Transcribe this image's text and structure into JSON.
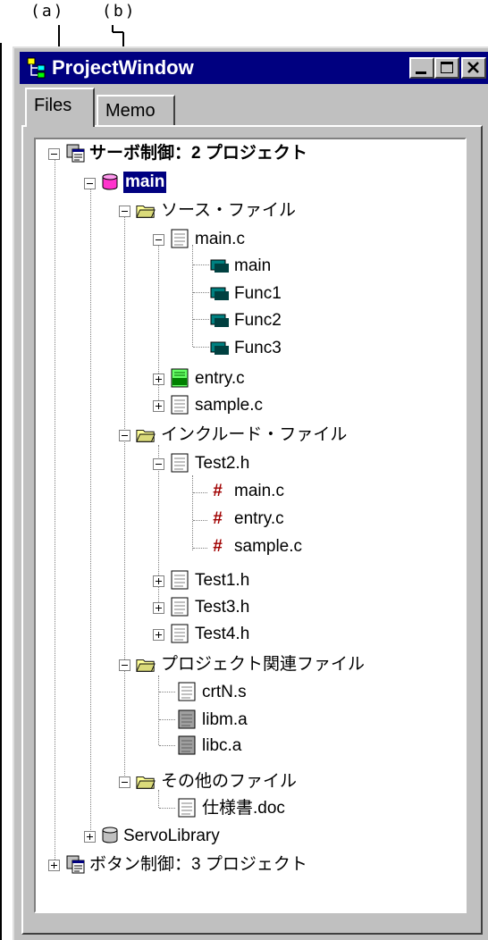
{
  "annotations": {
    "a": "(a)",
    "b": "(b)"
  },
  "window": {
    "title": "ProjectWindow"
  },
  "tabs": [
    {
      "label": "Files",
      "active": true
    },
    {
      "label": "Memo",
      "active": false
    }
  ],
  "tree": {
    "project1": "サーボ制御：2 プロジェクト",
    "main": "main",
    "source_folder": "ソース・ファイル",
    "main_c": "main.c",
    "fn_main": "main",
    "fn1": "Func1",
    "fn2": "Func2",
    "fn3": "Func3",
    "entry_c": "entry.c",
    "sample_c": "sample.c",
    "include_folder": "インクルード・ファイル",
    "test2_h": "Test2.h",
    "inc_main_c": "main.c",
    "inc_entry_c": "entry.c",
    "inc_sample_c": "sample.c",
    "test1_h": "Test1.h",
    "test3_h": "Test3.h",
    "test4_h": "Test4.h",
    "project_folder": "プロジェクト関連ファイル",
    "crtn_s": "crtN.s",
    "libm_a": "libm.a",
    "libc_a": "libc.a",
    "other_folder": "その他のファイル",
    "spec_doc": "仕様書.doc",
    "servo_library": "ServoLibrary",
    "project2": "ボタン制御：3 プロジェクト"
  },
  "icons": {
    "project": "project-icon",
    "module": "database-icon",
    "folder": "folder-icon",
    "file": "file-icon",
    "function": "function-icon",
    "include": "hash-icon",
    "option_file": "option-file-icon"
  },
  "colors": {
    "titlebar": "#000080",
    "selection": "#000080",
    "module_pink": "#ff33cc",
    "function_teal": "#008080",
    "hash_red": "#a00000",
    "folder_yellow": "#ffff99"
  }
}
